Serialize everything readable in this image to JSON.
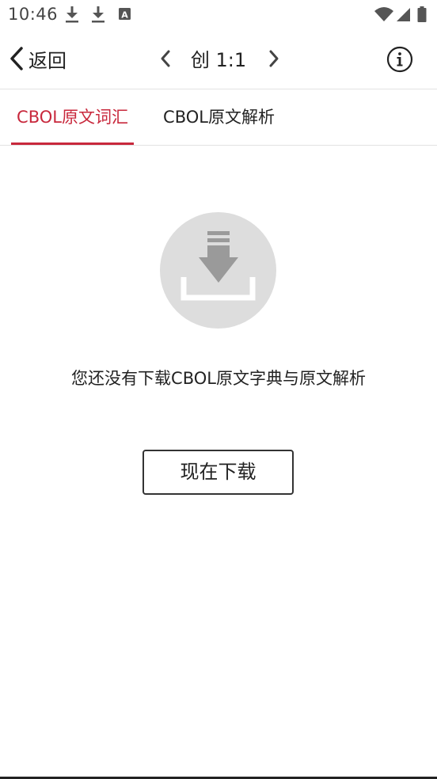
{
  "status_bar": {
    "time": "10:46",
    "left_icons": [
      "download-icon",
      "download-icon",
      "font-a-icon"
    ],
    "right_icons": [
      "wifi-icon",
      "signal-icon",
      "battery-icon"
    ]
  },
  "app_bar": {
    "back_label": "返回",
    "chapter": "创 1:1",
    "icons": [
      "chevron-left-icon",
      "chevron-right-icon",
      "info-icon"
    ]
  },
  "tabs": [
    {
      "label": "CBOL原文词汇",
      "active": true
    },
    {
      "label": "CBOL原文解析",
      "active": false
    }
  ],
  "empty_state": {
    "icon": "download-tray-icon",
    "message": "您还没有下载CBOL原文字典与原文解析",
    "button_label": "现在下载"
  },
  "colors": {
    "accent": "#c8283c",
    "icon_circle": "#dddddd",
    "text": "#222222"
  }
}
